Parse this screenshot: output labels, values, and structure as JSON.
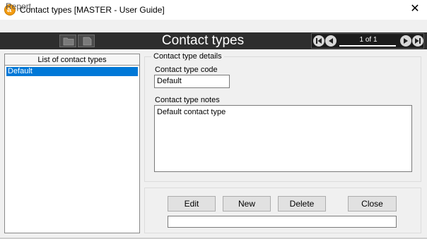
{
  "window": {
    "title": "Contact types [MASTER - User Guide]",
    "close_glyph": "✕",
    "app_icon_letter": "a",
    "app_icon_color": "#f39c12"
  },
  "menu": {
    "items": [
      "Report"
    ]
  },
  "header": {
    "title": "Contact types",
    "bar_color": "#2e2e2e",
    "nav": {
      "page_info": "1 of 1",
      "icons": [
        "nav-first-icon",
        "nav-prev-icon",
        "nav-next-icon",
        "nav-last-icon"
      ]
    },
    "tool_icons": [
      "folder-icon",
      "page-icon"
    ]
  },
  "list": {
    "header": "List of contact types",
    "items": [
      "Default"
    ],
    "selected_index": 0,
    "selection_color": "#0078d7"
  },
  "details": {
    "legend": "Contact type details",
    "code_label": "Contact type code",
    "code_value": "Default",
    "notes_label": "Contact type notes",
    "notes_value": "Default contact type"
  },
  "actions": {
    "edit": "Edit",
    "new": "New",
    "delete": "Delete",
    "close": "Close",
    "status_text": ""
  }
}
